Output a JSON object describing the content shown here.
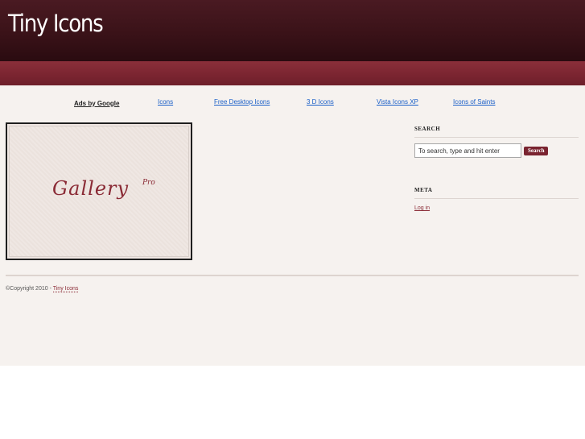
{
  "header": {
    "site_title": "Tiny Icons"
  },
  "adsbar": {
    "label": "Ads by Google",
    "links": [
      "Icons",
      "Free Desktop Icons",
      "3 D Icons",
      "Vista Icons XP",
      "Icons of Saints"
    ]
  },
  "gallery": {
    "logo_text": "Gallery",
    "logo_superscript": "Pro"
  },
  "sidebar": {
    "search_title": "SEARCH",
    "search_value": "To search, type and hit enter",
    "search_button": "Search",
    "meta_title": "META",
    "login_label": "Log in"
  },
  "footer": {
    "copyright": "©Copyright 2010 - ",
    "site_link": "Tiny Icons"
  },
  "colors": {
    "header": "#3a1218",
    "band": "#7a2430",
    "accent": "#8a2a35",
    "link": "#1a5fc8",
    "content_bg": "#f6f2ef"
  }
}
